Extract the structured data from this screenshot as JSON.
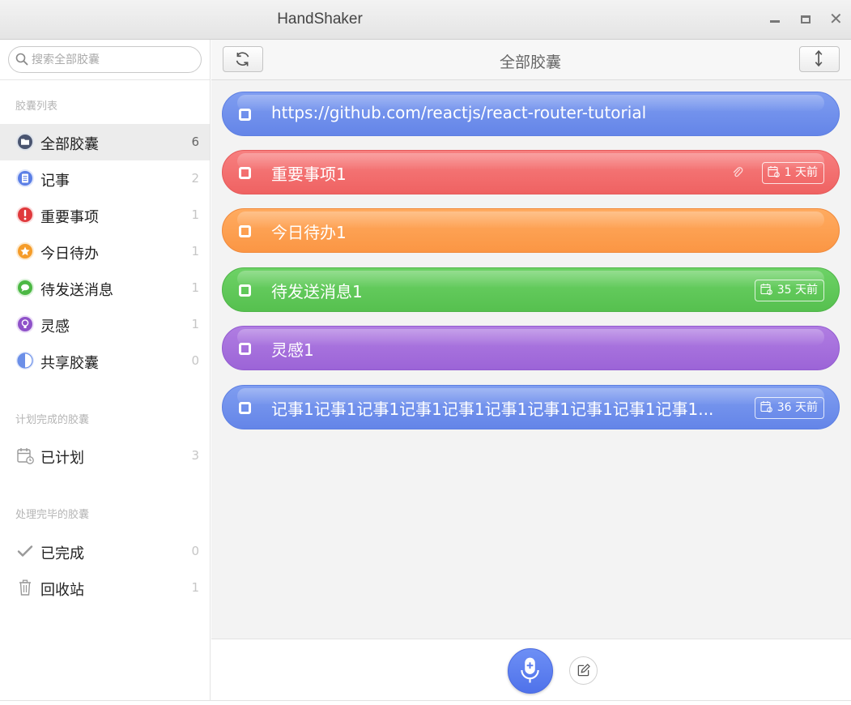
{
  "window": {
    "title": "HandShaker"
  },
  "search": {
    "placeholder": "搜索全部胶囊"
  },
  "sidebar": {
    "section_capsules": "胶囊列表",
    "items": [
      {
        "label": "全部胶囊",
        "count": "6",
        "icon": "folder-icon",
        "color": "#4a5570"
      },
      {
        "label": "记事",
        "count": "2",
        "icon": "note-icon",
        "color": "#5b7fe6"
      },
      {
        "label": "重要事项",
        "count": "1",
        "icon": "exclamation-icon",
        "color": "#e0393c"
      },
      {
        "label": "今日待办",
        "count": "1",
        "icon": "star-icon",
        "color": "#f59c29"
      },
      {
        "label": "待发送消息",
        "count": "1",
        "icon": "message-icon",
        "color": "#4cb844"
      },
      {
        "label": "灵感",
        "count": "1",
        "icon": "lightbulb-icon",
        "color": "#8f52c9"
      },
      {
        "label": "共享胶囊",
        "count": "0",
        "icon": "half-circle-icon",
        "color": "#6b8fe8"
      }
    ],
    "section_planned": "计划完成的胶囊",
    "planned": {
      "label": "已计划",
      "count": "3",
      "icon": "calendar-icon"
    },
    "section_done": "处理完毕的胶囊",
    "done": [
      {
        "label": "已完成",
        "count": "0",
        "icon": "checkmark-icon"
      },
      {
        "label": "回收站",
        "count": "1",
        "icon": "trash-icon"
      }
    ]
  },
  "main": {
    "title": "全部胶囊",
    "capsules": [
      {
        "text": "https://github.com/reactjs/react-router-tutorial",
        "color": "blue",
        "badge": "",
        "attachment": false
      },
      {
        "text": "重要事项1",
        "color": "red",
        "badge": "1 天前",
        "attachment": true
      },
      {
        "text": "今日待办1",
        "color": "orange",
        "badge": "",
        "attachment": false
      },
      {
        "text": "待发送消息1",
        "color": "green",
        "badge": "35 天前",
        "attachment": false
      },
      {
        "text": "灵感1",
        "color": "purple",
        "badge": "",
        "attachment": false
      },
      {
        "text": "记事1记事1记事1记事1记事1记事1记事1记事1记事1记事1...",
        "color": "blue",
        "badge": "36 天前",
        "attachment": false
      }
    ]
  },
  "colors": {
    "blue": "#6b8cec",
    "red": "#f36b6b",
    "orange": "#ff9f4e",
    "green": "#5ec857",
    "purple": "#a56fdc",
    "mic": "#5a7cee"
  }
}
